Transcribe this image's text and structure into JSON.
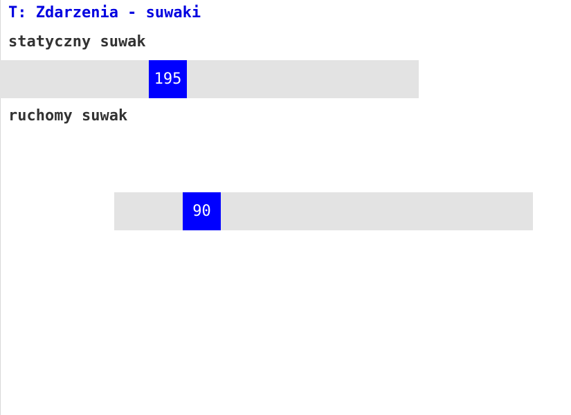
{
  "page": {
    "title": "T: Zdarzenia - suwaki"
  },
  "static_slider": {
    "label": "statyczny suwak",
    "value": "195",
    "thumb_color": "#0000ff",
    "track_color": "#e3e3e3"
  },
  "moving_slider": {
    "label": "ruchomy suwak",
    "value": "90",
    "thumb_color": "#0000ff",
    "track_color": "#e3e3e3"
  },
  "colors": {
    "title": "#0000e0",
    "label": "#333333"
  }
}
